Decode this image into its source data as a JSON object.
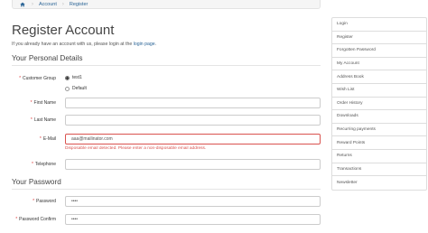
{
  "breadcrumb": {
    "items": [
      "Account",
      "Register"
    ]
  },
  "heading": "Register Account",
  "intro": {
    "text": "If you already have an account with us, please login at the ",
    "link": "login page",
    "suffix": "."
  },
  "personal": {
    "legend": "Your Personal Details",
    "customer_group": {
      "label": "Customer Group",
      "options": [
        "test1",
        "Default"
      ],
      "selected": "test1"
    },
    "first_name": {
      "label": "First Name",
      "value": ""
    },
    "last_name": {
      "label": "Last Name",
      "value": ""
    },
    "email": {
      "label": "E-Mail",
      "value": "aaa@mailinator.com",
      "error": "Disposable email detected. Please enter a non-disposable email address."
    },
    "telephone": {
      "label": "Telephone",
      "value": ""
    }
  },
  "password_section": {
    "legend": "Your Password",
    "password": {
      "label": "Password",
      "value": "••••"
    },
    "confirm": {
      "label": "Password Confirm",
      "value": "••••"
    }
  },
  "sidebar": {
    "items": [
      "Login",
      "Register",
      "Forgotten Password",
      "My Account",
      "Address Book",
      "Wish List",
      "Order History",
      "Downloads",
      "Recurring payments",
      "Reward Points",
      "Returns",
      "Transactions",
      "Newsletter"
    ]
  }
}
